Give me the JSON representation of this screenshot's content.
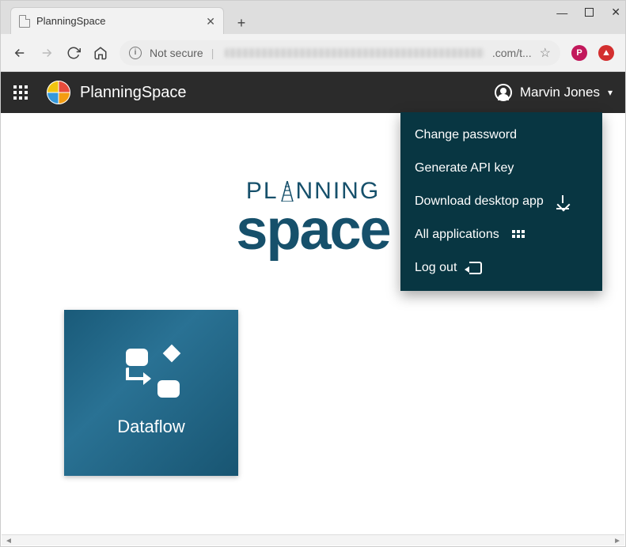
{
  "browser": {
    "tab_title": "PlanningSpace",
    "not_secure_label": "Not secure",
    "url_suffix": ".com/t..."
  },
  "header": {
    "app_name": "PlanningSpace",
    "user_name": "Marvin Jones"
  },
  "user_menu": {
    "items": [
      {
        "label": "Change password",
        "icon": null
      },
      {
        "label": "Generate API key",
        "icon": null
      },
      {
        "label": "Download desktop app",
        "icon": "download"
      },
      {
        "label": "All applications",
        "icon": "grid"
      },
      {
        "label": "Log out",
        "icon": "logout"
      }
    ]
  },
  "logo": {
    "line1": "PLANNING",
    "line2": "space"
  },
  "tiles": [
    {
      "label": "Dataflow"
    }
  ],
  "profile_badge": "P"
}
